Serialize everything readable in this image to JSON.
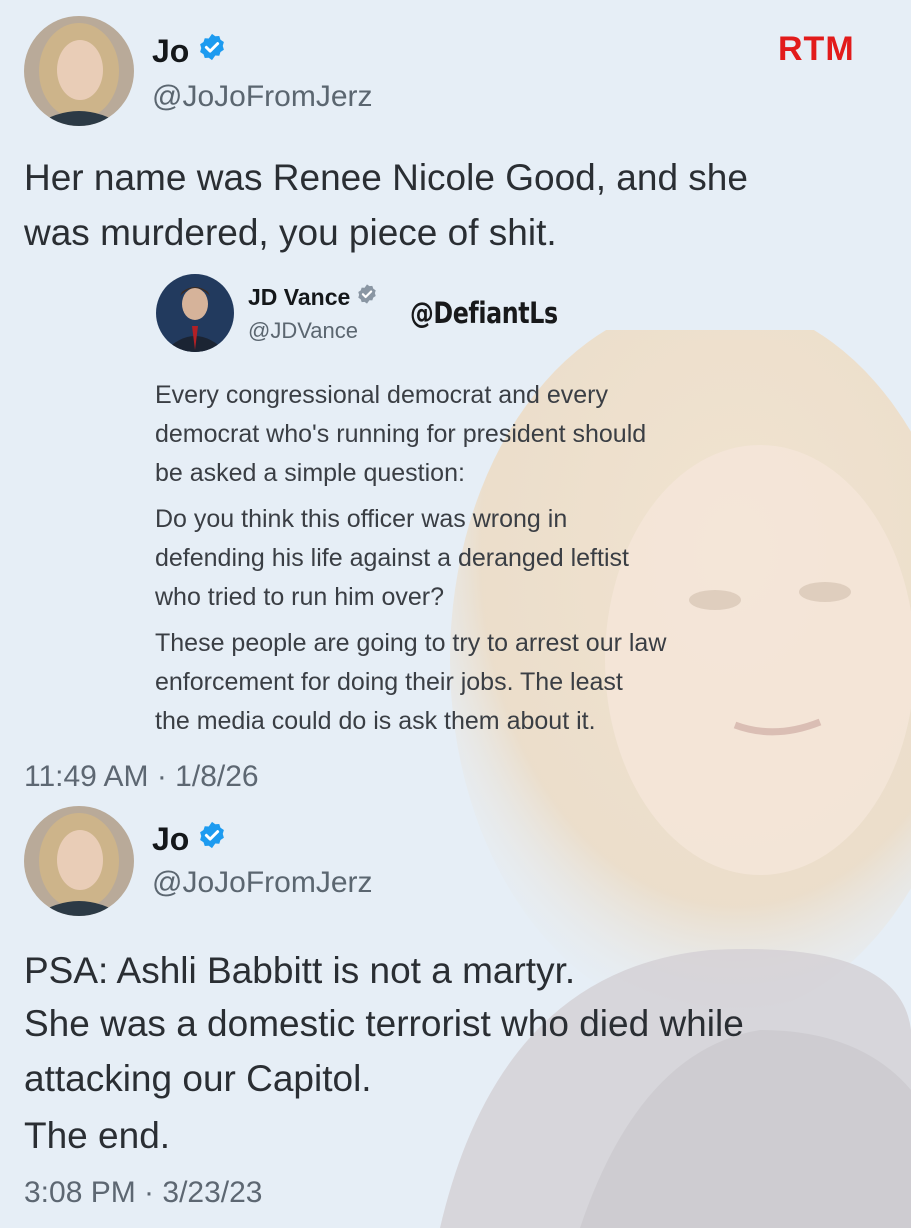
{
  "brand": "RTM",
  "watermark": "@DefiantLs",
  "tweet1": {
    "name": "Jo",
    "handle": "@JoJoFromJerz",
    "text": "Her name was Renee Nicole Good, and she\nwas murdered, you piece of shit."
  },
  "quoted": {
    "name": "JD Vance",
    "handle": "@JDVance",
    "para1": "Every congressional democrat and every\ndemocrat who's running for president should\nbe asked a simple question:",
    "para2": "Do you think this officer was wrong in\ndefending his life against a deranged leftist\nwho tried to run him over?",
    "para3": "These people are going to try to arrest our law\nenforcement for doing their jobs. The least\nthe media could do is ask them about it."
  },
  "tweet1_time": "11:49 AM · 1/8/26",
  "tweet2": {
    "name": "Jo",
    "handle": "@JoJoFromJerz",
    "line1": "PSA: Ashli Babbitt is not a martyr.",
    "line2": "She was a domestic terrorist who died while\nattacking our Capitol.",
    "line3": "The end."
  },
  "tweet2_time": "3:08 PM · 3/23/23",
  "colors": {
    "verified": "#1d9bf0",
    "brand": "#e21b1b",
    "background": "#e6eef6"
  },
  "icons": [
    "verified-badge-icon",
    "avatar-photo"
  ]
}
